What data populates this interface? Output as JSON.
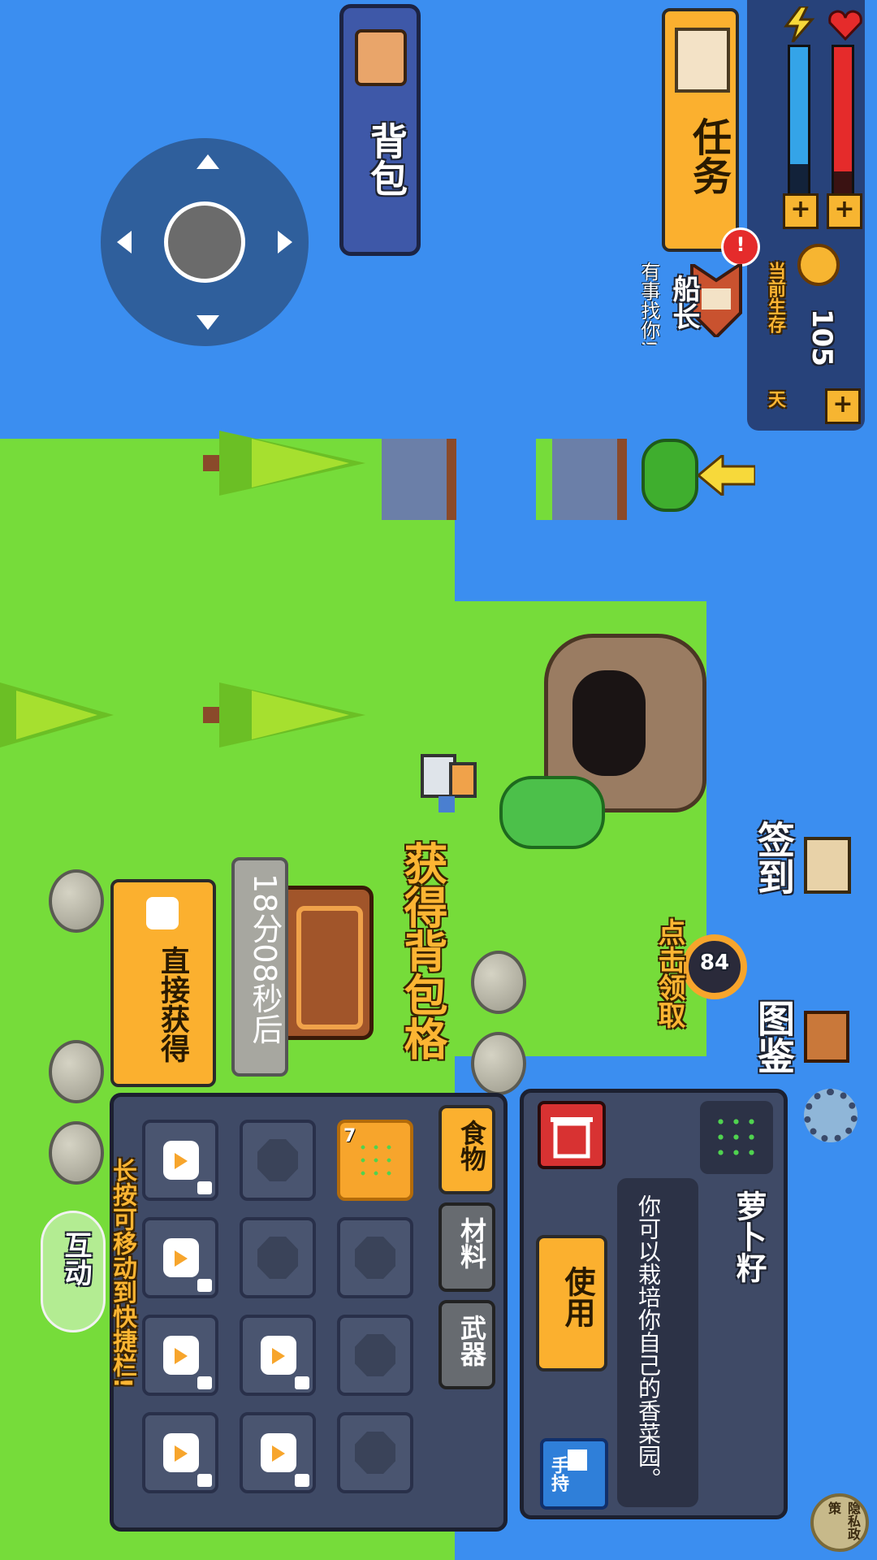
{
  "hud": {
    "quest_label": "任务",
    "backpack_label": "背包",
    "survival_prefix": "当前生存",
    "survival_days": "105",
    "survival_unit": "天",
    "npc_name": "船长",
    "npc_subtitle": "有事找你!",
    "health_fraction": 0.85,
    "energy_fraction": 0.8
  },
  "side_buttons": {
    "sign_in": "签到",
    "catalog": "图鉴"
  },
  "reward": {
    "count": "84",
    "claim_label": "点击领取"
  },
  "backpack_offer": {
    "title": "获得背包格",
    "timer": "18分08秒后",
    "direct_label": "直接获得"
  },
  "inventory": {
    "tabs": [
      "食物",
      "材料",
      "武器"
    ],
    "active_tab": 0,
    "selected_count": "7",
    "hint": "长按可移动到快捷栏!",
    "interact_label": "互动"
  },
  "item_detail": {
    "name": "萝卜籽",
    "description": "你可以栽培你自己的香菜园。",
    "use_label": "使用",
    "hold_label": "手持"
  },
  "privacy": "隐私政策",
  "icons": {
    "quest": "scroll-icon",
    "backpack": "backpack-icon",
    "coin": "coin-icon",
    "heart": "heart-icon",
    "energy": "lightning-icon",
    "settings": "gear-icon",
    "delete": "trash-icon",
    "hold": "hand-icon"
  },
  "colors": {
    "water": "#3b8ef0",
    "grass": "#76dc3a",
    "accent": "#fbb02f",
    "panel": "#3f4a66",
    "health": "#e52b2b",
    "energy": "#34a4e8"
  }
}
